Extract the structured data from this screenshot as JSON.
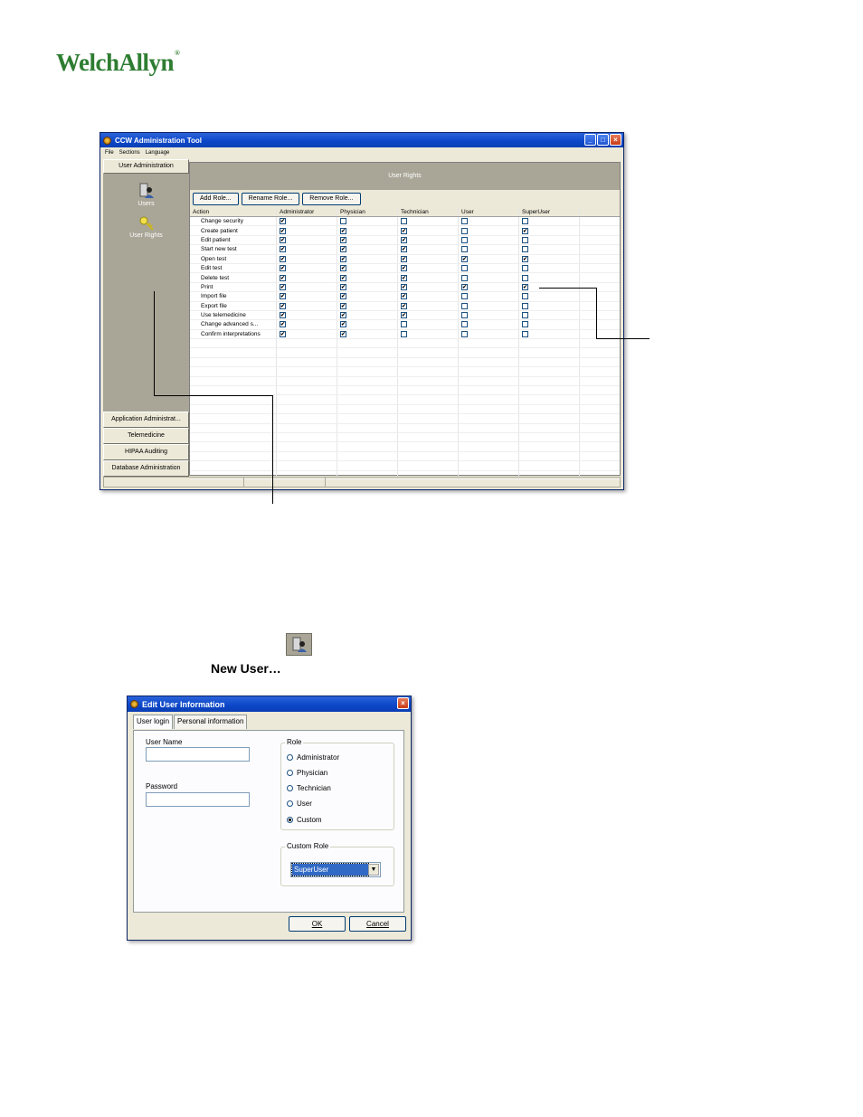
{
  "logo": {
    "text": "WelchAllyn",
    "reg": "®"
  },
  "main_window": {
    "title": "CCW Administration Tool",
    "menu": [
      "File",
      "Sections",
      "Language"
    ],
    "left_panel": {
      "header": "User Administration",
      "items": [
        {
          "label": "Users",
          "icon": "users-icon"
        },
        {
          "label": "User Rights",
          "icon": "key-icon"
        }
      ],
      "bottom_sections": [
        "Application Administrat...",
        "Telemedicine",
        "HIPAA Auditing",
        "Database Administration"
      ]
    },
    "right_panel": {
      "header": "User Rights",
      "toolbar": [
        "Add Role...",
        "Rename Role...",
        "Remove Role..."
      ],
      "columns": [
        "Action",
        "Administrator",
        "Physician",
        "Technician",
        "User",
        "SuperUser"
      ],
      "rows": [
        {
          "action": "Change security",
          "checks": [
            true,
            false,
            false,
            false,
            false
          ]
        },
        {
          "action": "Create patient",
          "checks": [
            true,
            true,
            true,
            false,
            true
          ]
        },
        {
          "action": "Edit patient",
          "checks": [
            true,
            true,
            true,
            false,
            false
          ]
        },
        {
          "action": "Start new test",
          "checks": [
            true,
            true,
            true,
            false,
            false
          ]
        },
        {
          "action": "Open test",
          "checks": [
            true,
            true,
            true,
            true,
            true
          ]
        },
        {
          "action": "Edit test",
          "checks": [
            true,
            true,
            true,
            false,
            false
          ]
        },
        {
          "action": "Delete test",
          "checks": [
            true,
            true,
            true,
            false,
            false
          ]
        },
        {
          "action": "Print",
          "checks": [
            true,
            true,
            true,
            true,
            true
          ]
        },
        {
          "action": "Import file",
          "checks": [
            true,
            true,
            true,
            false,
            false
          ]
        },
        {
          "action": "Export file",
          "checks": [
            true,
            true,
            true,
            false,
            false
          ]
        },
        {
          "action": "Use telemedicine",
          "checks": [
            true,
            true,
            true,
            false,
            false
          ]
        },
        {
          "action": "Change advanced s...",
          "checks": [
            true,
            true,
            false,
            false,
            false
          ]
        },
        {
          "action": "Confirm interpretations",
          "checks": [
            true,
            true,
            false,
            false,
            false
          ]
        }
      ]
    }
  },
  "new_user_label": "New User…",
  "dialog": {
    "title": "Edit User Information",
    "tabs": [
      "User login",
      "Personal information"
    ],
    "user_name_label": "User Name",
    "user_name_value": "",
    "password_label": "Password",
    "password_value": "",
    "role_title": "Role",
    "roles": [
      {
        "label": "Administrator",
        "selected": false
      },
      {
        "label": "Physician",
        "selected": false
      },
      {
        "label": "Technician",
        "selected": false
      },
      {
        "label": "User",
        "selected": false
      },
      {
        "label": "Custom",
        "selected": true
      }
    ],
    "custom_role_title": "Custom Role",
    "custom_role_value": "SuperUser",
    "ok_label": "OK",
    "cancel_label": "Cancel"
  }
}
